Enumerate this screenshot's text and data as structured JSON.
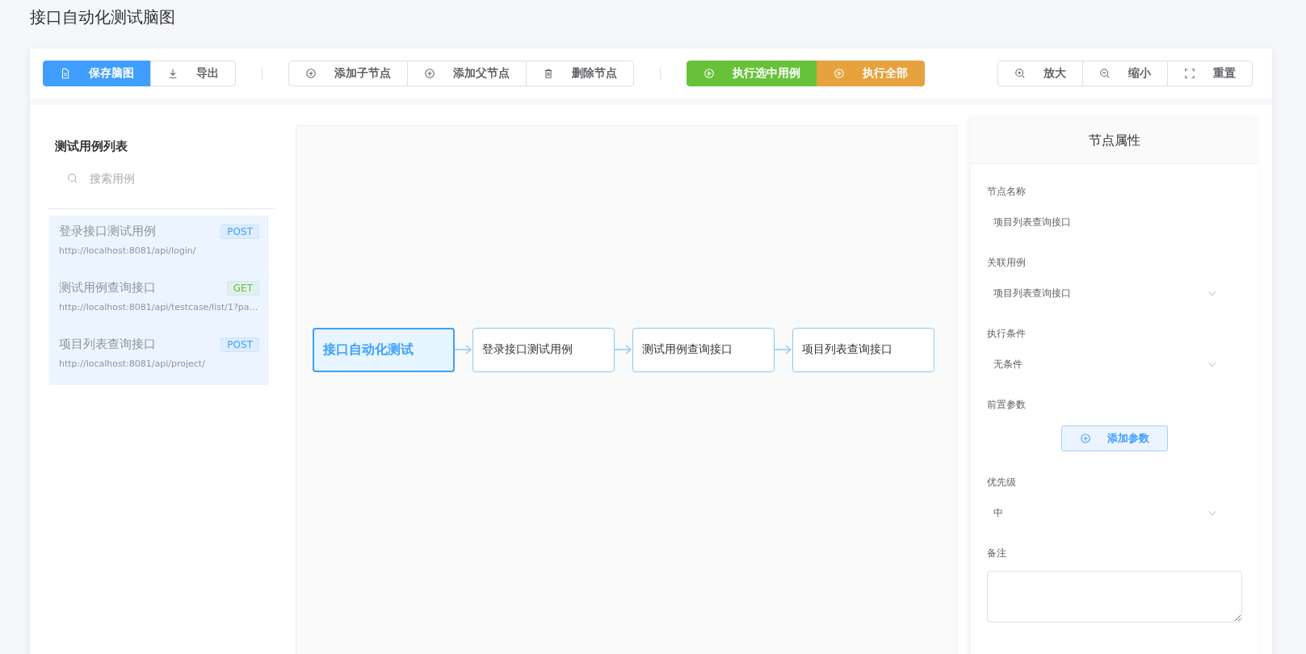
{
  "page_title": "接口自动化测试脑图",
  "toolbar": {
    "groups": [
      {
        "buttons": [
          {
            "label": "保存脑图",
            "kind": "primary"
          },
          {
            "label": "导出",
            "kind": "default"
          }
        ]
      },
      {
        "buttons": [
          {
            "label": "添加子节点",
            "kind": "default"
          },
          {
            "label": "添加父节点",
            "kind": "default"
          },
          {
            "label": "删除节点",
            "kind": "default"
          }
        ]
      },
      {
        "buttons": [
          {
            "label": "执行选中用例",
            "kind": "success"
          },
          {
            "label": "执行全部",
            "kind": "warning"
          }
        ]
      },
      {
        "buttons": [
          {
            "label": "放大",
            "kind": "default"
          },
          {
            "label": "缩小",
            "kind": "default"
          },
          {
            "label": "重置",
            "kind": "default"
          }
        ]
      }
    ]
  },
  "case_list": {
    "title": "测试用例列表",
    "search": {
      "placeholder": "搜索用例"
    },
    "items": [
      {
        "name": "登录接口测试用例",
        "method": "POST",
        "color": "#409eff",
        "url": "http://localhost:8081/api/login/"
      },
      {
        "name": "测试用例查询接口",
        "method": "GET",
        "color": "#67c23a",
        "url": "http://localhost:8081/api/testcase/list/1?pa…"
      },
      {
        "name": "项目列表查询接口",
        "method": "POST",
        "color": "#409eff",
        "url": "http://localhost:8081/api/project/"
      }
    ]
  },
  "mind_map": {
    "nodes": [
      {
        "label": "接口自动化测试",
        "kind": "root",
        "selected": true
      },
      {
        "label": "登录接口测试用例",
        "kind": "child",
        "selected": false
      },
      {
        "label": "测试用例查询接口",
        "kind": "child",
        "selected": false
      },
      {
        "label": "项目列表查询接口",
        "kind": "child",
        "selected": false
      }
    ]
  },
  "properties": {
    "title": "节点属性",
    "fields": [
      {
        "label": "节点名称",
        "kind": "text",
        "value": "项目列表查询接口"
      },
      {
        "label": "关联用例",
        "kind": "select",
        "value": "项目列表查询接口"
      },
      {
        "label": "执行条件",
        "kind": "select",
        "value": "无条件"
      },
      {
        "label": "前置参数",
        "kind": "button",
        "value": "添加参数"
      },
      {
        "label": "优先级",
        "kind": "select",
        "value": "中"
      },
      {
        "label": "备注",
        "kind": "textarea"
      }
    ]
  }
}
